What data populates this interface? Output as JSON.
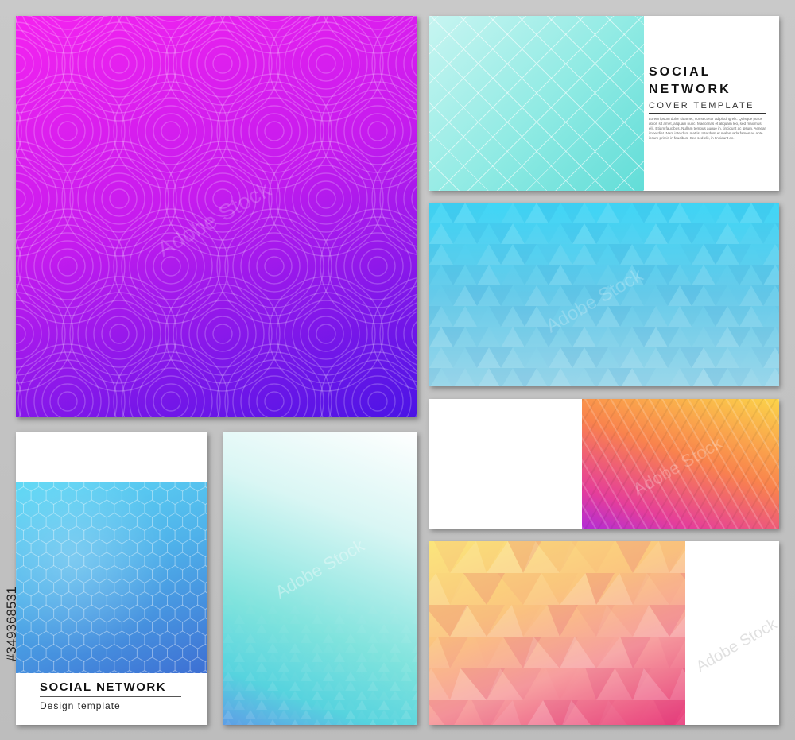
{
  "cover_top_right": {
    "title_line1": "SOCIAL",
    "title_line2": "NETWORK",
    "subtitle": "COVER TEMPLATE",
    "body_text": "Lorem ipsum dolor sit amet, consectetur adipiscing elit. Quisque purus dolor, sit amet, aliquam nunc. Maecenas et aliquam leo, sed maximus elit. Etiam faucibus. Nullam tempus augue in, tincidunt ac ipsum. Aenean imperdiet. Nam interdum mattis. Interdum et malesuada fames ac ante ipsum primis in faucibus. Sed sed elit, in tincidunt ac."
  },
  "cover_bottom_left": {
    "title": "SOCIAL NETWORK",
    "subtitle": "Design template"
  },
  "watermark": {
    "text": "Adobe Stock",
    "side_id": "#349368531"
  },
  "colors": {
    "background": "#c4c4c4",
    "magenta": "#f21ef0",
    "violet": "#4f14e6",
    "aqua": "#7ee8e0",
    "sky_blue": "#4fd2f3",
    "orange_yellow": "#fbd34a",
    "pink": "#e53e9a"
  }
}
